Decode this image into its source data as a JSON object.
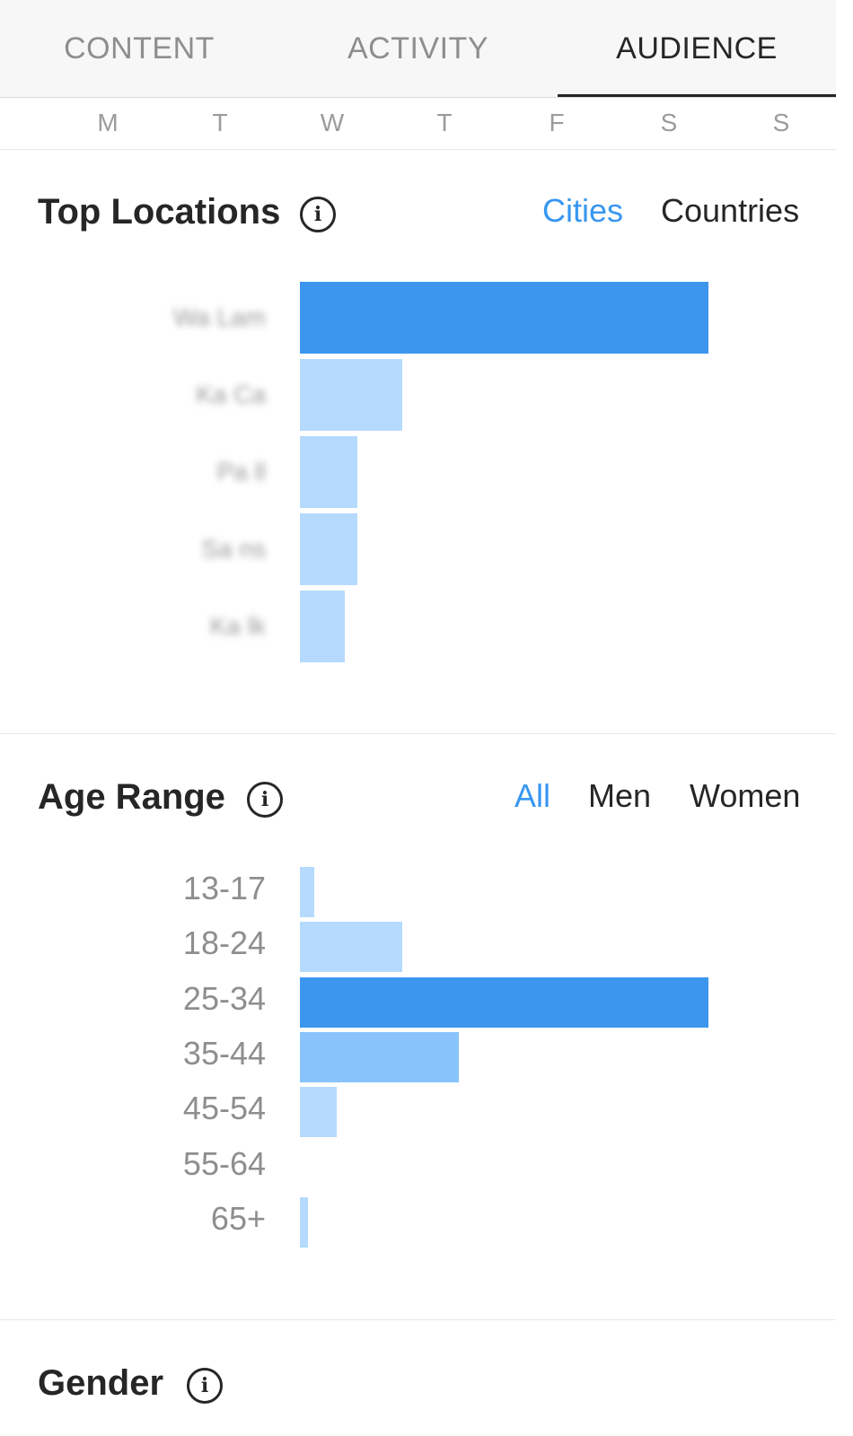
{
  "tabs": [
    {
      "label": "CONTENT",
      "active": false
    },
    {
      "label": "ACTIVITY",
      "active": false
    },
    {
      "label": "AUDIENCE",
      "active": true
    }
  ],
  "weekdays": [
    "M",
    "T",
    "W",
    "T",
    "F",
    "S",
    "S"
  ],
  "top_locations": {
    "title": "Top Locations",
    "info_icon": "info-icon",
    "filters": [
      {
        "label": "Cities",
        "selected": true
      },
      {
        "label": "Countries",
        "selected": false
      }
    ],
    "labels_obscured": true
  },
  "age_range": {
    "title": "Age Range",
    "info_icon": "info-icon",
    "filters": [
      {
        "label": "All",
        "selected": true
      },
      {
        "label": "Men",
        "selected": false
      },
      {
        "label": "Women",
        "selected": false
      }
    ],
    "categories": [
      "13-17",
      "18-24",
      "25-34",
      "35-44",
      "45-54",
      "55-64",
      "65+"
    ]
  },
  "gender": {
    "title": "Gender",
    "info_icon": "info-icon"
  },
  "colors": {
    "accent": "#3897f0",
    "bar_top": "#3d96ee",
    "bar_mid": "#88c4fb",
    "bar_light": "#b6dafd",
    "text_dark": "#262626",
    "text_muted": "#8e8e8e"
  },
  "chart_data": [
    {
      "type": "bar",
      "orientation": "horizontal",
      "name": "Top Locations",
      "categories": [
        "",
        "",
        "",
        "",
        ""
      ],
      "values": [
        100,
        25,
        14,
        14,
        11
      ],
      "value_unit": "relative share of top location (percent), unlabeled",
      "highlight_index": 0
    },
    {
      "type": "bar",
      "orientation": "horizontal",
      "name": "Age Range",
      "categories": [
        "13-17",
        "18-24",
        "25-34",
        "35-44",
        "45-54",
        "55-64",
        "65+"
      ],
      "values": [
        3.5,
        25,
        100,
        39,
        9,
        0,
        2
      ],
      "value_unit": "relative share of top age bucket (percent), unlabeled",
      "highlight_index": 2
    }
  ]
}
